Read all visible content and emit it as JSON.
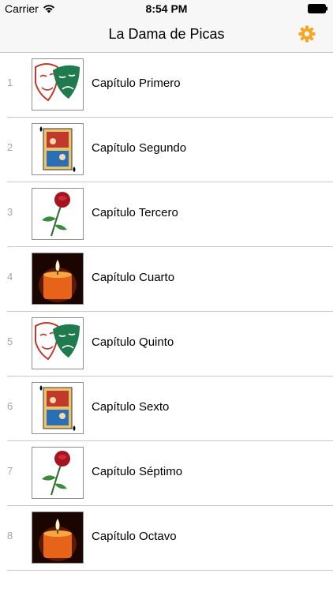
{
  "status_bar": {
    "carrier": "Carrier",
    "time": "8:54 PM"
  },
  "nav": {
    "title": "La Dama de Picas",
    "settings_icon": "gear-icon"
  },
  "chapters": [
    {
      "number": "1",
      "title": "Capítulo Primero",
      "image": "theater-masks"
    },
    {
      "number": "2",
      "title": "Capítulo Segundo",
      "image": "queen-of-spades"
    },
    {
      "number": "3",
      "title": "Capítulo Tercero",
      "image": "red-rose"
    },
    {
      "number": "4",
      "title": "Capítulo Cuarto",
      "image": "candle"
    },
    {
      "number": "5",
      "title": "Capítulo Quinto",
      "image": "theater-masks"
    },
    {
      "number": "6",
      "title": "Capítulo Sexto",
      "image": "queen-of-spades"
    },
    {
      "number": "7",
      "title": "Capítulo Séptimo",
      "image": "red-rose"
    },
    {
      "number": "8",
      "title": "Capítulo Octavo",
      "image": "candle"
    }
  ],
  "colors": {
    "accent": "#f5a623",
    "separator": "#c8c7cc",
    "number_gray": "#a5a5a5"
  }
}
